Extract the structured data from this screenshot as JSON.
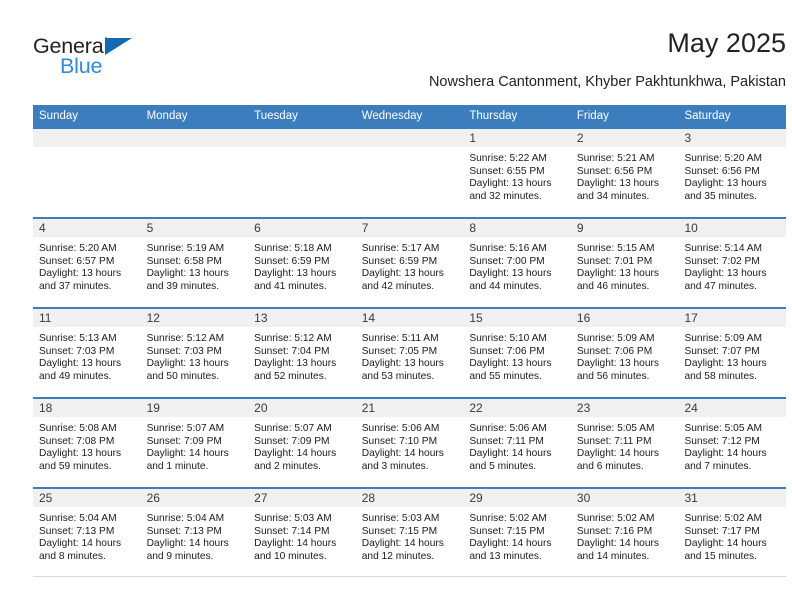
{
  "brand": {
    "name_part1": "General",
    "name_part2": "Blue",
    "triangle_color": "#1569b1",
    "blue_color": "#2b8ddb"
  },
  "header": {
    "title": "May 2025",
    "subtitle": "Nowshera Cantonment, Khyber Pakhtunkhwa, Pakistan",
    "header_bg_color": "#3b7dbd",
    "day_band_color": "#f0f0f0"
  },
  "weekday_labels": [
    "Sunday",
    "Monday",
    "Tuesday",
    "Wednesday",
    "Thursday",
    "Friday",
    "Saturday"
  ],
  "weeks": [
    [
      {
        "day": "",
        "empty": true
      },
      {
        "day": "",
        "empty": true
      },
      {
        "day": "",
        "empty": true
      },
      {
        "day": "",
        "empty": true
      },
      {
        "day": "1",
        "sunrise": "Sunrise: 5:22 AM",
        "sunset": "Sunset: 6:55 PM",
        "daylight1": "Daylight: 13 hours",
        "daylight2": "and 32 minutes."
      },
      {
        "day": "2",
        "sunrise": "Sunrise: 5:21 AM",
        "sunset": "Sunset: 6:56 PM",
        "daylight1": "Daylight: 13 hours",
        "daylight2": "and 34 minutes."
      },
      {
        "day": "3",
        "sunrise": "Sunrise: 5:20 AM",
        "sunset": "Sunset: 6:56 PM",
        "daylight1": "Daylight: 13 hours",
        "daylight2": "and 35 minutes."
      }
    ],
    [
      {
        "day": "4",
        "sunrise": "Sunrise: 5:20 AM",
        "sunset": "Sunset: 6:57 PM",
        "daylight1": "Daylight: 13 hours",
        "daylight2": "and 37 minutes."
      },
      {
        "day": "5",
        "sunrise": "Sunrise: 5:19 AM",
        "sunset": "Sunset: 6:58 PM",
        "daylight1": "Daylight: 13 hours",
        "daylight2": "and 39 minutes."
      },
      {
        "day": "6",
        "sunrise": "Sunrise: 5:18 AM",
        "sunset": "Sunset: 6:59 PM",
        "daylight1": "Daylight: 13 hours",
        "daylight2": "and 41 minutes."
      },
      {
        "day": "7",
        "sunrise": "Sunrise: 5:17 AM",
        "sunset": "Sunset: 6:59 PM",
        "daylight1": "Daylight: 13 hours",
        "daylight2": "and 42 minutes."
      },
      {
        "day": "8",
        "sunrise": "Sunrise: 5:16 AM",
        "sunset": "Sunset: 7:00 PM",
        "daylight1": "Daylight: 13 hours",
        "daylight2": "and 44 minutes."
      },
      {
        "day": "9",
        "sunrise": "Sunrise: 5:15 AM",
        "sunset": "Sunset: 7:01 PM",
        "daylight1": "Daylight: 13 hours",
        "daylight2": "and 46 minutes."
      },
      {
        "day": "10",
        "sunrise": "Sunrise: 5:14 AM",
        "sunset": "Sunset: 7:02 PM",
        "daylight1": "Daylight: 13 hours",
        "daylight2": "and 47 minutes."
      }
    ],
    [
      {
        "day": "11",
        "sunrise": "Sunrise: 5:13 AM",
        "sunset": "Sunset: 7:03 PM",
        "daylight1": "Daylight: 13 hours",
        "daylight2": "and 49 minutes."
      },
      {
        "day": "12",
        "sunrise": "Sunrise: 5:12 AM",
        "sunset": "Sunset: 7:03 PM",
        "daylight1": "Daylight: 13 hours",
        "daylight2": "and 50 minutes."
      },
      {
        "day": "13",
        "sunrise": "Sunrise: 5:12 AM",
        "sunset": "Sunset: 7:04 PM",
        "daylight1": "Daylight: 13 hours",
        "daylight2": "and 52 minutes."
      },
      {
        "day": "14",
        "sunrise": "Sunrise: 5:11 AM",
        "sunset": "Sunset: 7:05 PM",
        "daylight1": "Daylight: 13 hours",
        "daylight2": "and 53 minutes."
      },
      {
        "day": "15",
        "sunrise": "Sunrise: 5:10 AM",
        "sunset": "Sunset: 7:06 PM",
        "daylight1": "Daylight: 13 hours",
        "daylight2": "and 55 minutes."
      },
      {
        "day": "16",
        "sunrise": "Sunrise: 5:09 AM",
        "sunset": "Sunset: 7:06 PM",
        "daylight1": "Daylight: 13 hours",
        "daylight2": "and 56 minutes."
      },
      {
        "day": "17",
        "sunrise": "Sunrise: 5:09 AM",
        "sunset": "Sunset: 7:07 PM",
        "daylight1": "Daylight: 13 hours",
        "daylight2": "and 58 minutes."
      }
    ],
    [
      {
        "day": "18",
        "sunrise": "Sunrise: 5:08 AM",
        "sunset": "Sunset: 7:08 PM",
        "daylight1": "Daylight: 13 hours",
        "daylight2": "and 59 minutes."
      },
      {
        "day": "19",
        "sunrise": "Sunrise: 5:07 AM",
        "sunset": "Sunset: 7:09 PM",
        "daylight1": "Daylight: 14 hours",
        "daylight2": "and 1 minute."
      },
      {
        "day": "20",
        "sunrise": "Sunrise: 5:07 AM",
        "sunset": "Sunset: 7:09 PM",
        "daylight1": "Daylight: 14 hours",
        "daylight2": "and 2 minutes."
      },
      {
        "day": "21",
        "sunrise": "Sunrise: 5:06 AM",
        "sunset": "Sunset: 7:10 PM",
        "daylight1": "Daylight: 14 hours",
        "daylight2": "and 3 minutes."
      },
      {
        "day": "22",
        "sunrise": "Sunrise: 5:06 AM",
        "sunset": "Sunset: 7:11 PM",
        "daylight1": "Daylight: 14 hours",
        "daylight2": "and 5 minutes."
      },
      {
        "day": "23",
        "sunrise": "Sunrise: 5:05 AM",
        "sunset": "Sunset: 7:11 PM",
        "daylight1": "Daylight: 14 hours",
        "daylight2": "and 6 minutes."
      },
      {
        "day": "24",
        "sunrise": "Sunrise: 5:05 AM",
        "sunset": "Sunset: 7:12 PM",
        "daylight1": "Daylight: 14 hours",
        "daylight2": "and 7 minutes."
      }
    ],
    [
      {
        "day": "25",
        "sunrise": "Sunrise: 5:04 AM",
        "sunset": "Sunset: 7:13 PM",
        "daylight1": "Daylight: 14 hours",
        "daylight2": "and 8 minutes."
      },
      {
        "day": "26",
        "sunrise": "Sunrise: 5:04 AM",
        "sunset": "Sunset: 7:13 PM",
        "daylight1": "Daylight: 14 hours",
        "daylight2": "and 9 minutes."
      },
      {
        "day": "27",
        "sunrise": "Sunrise: 5:03 AM",
        "sunset": "Sunset: 7:14 PM",
        "daylight1": "Daylight: 14 hours",
        "daylight2": "and 10 minutes."
      },
      {
        "day": "28",
        "sunrise": "Sunrise: 5:03 AM",
        "sunset": "Sunset: 7:15 PM",
        "daylight1": "Daylight: 14 hours",
        "daylight2": "and 12 minutes."
      },
      {
        "day": "29",
        "sunrise": "Sunrise: 5:02 AM",
        "sunset": "Sunset: 7:15 PM",
        "daylight1": "Daylight: 14 hours",
        "daylight2": "and 13 minutes."
      },
      {
        "day": "30",
        "sunrise": "Sunrise: 5:02 AM",
        "sunset": "Sunset: 7:16 PM",
        "daylight1": "Daylight: 14 hours",
        "daylight2": "and 14 minutes."
      },
      {
        "day": "31",
        "sunrise": "Sunrise: 5:02 AM",
        "sunset": "Sunset: 7:17 PM",
        "daylight1": "Daylight: 14 hours",
        "daylight2": "and 15 minutes."
      }
    ]
  ]
}
